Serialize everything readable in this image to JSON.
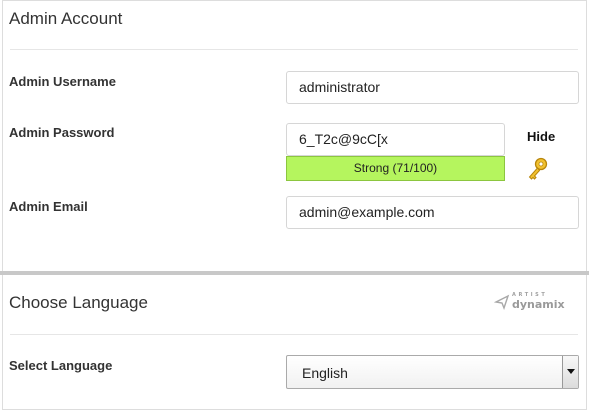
{
  "admin_account": {
    "title": "Admin Account",
    "username": {
      "label": "Admin Username",
      "value": "administrator"
    },
    "password": {
      "label": "Admin Password",
      "value": "6_T2c@9cC[x",
      "strength_text": "Strong (71/100)",
      "strength_score": 71,
      "strength_color": "#b5f55e",
      "hide_label": "Hide",
      "generate_icon": "key-icon"
    },
    "email": {
      "label": "Admin Email",
      "value": "admin@example.com"
    }
  },
  "language": {
    "title": "Choose Language",
    "logo": {
      "small_text": "ARTIST",
      "big_text": "dynamix"
    },
    "select": {
      "label": "Select Language",
      "value": "English"
    }
  }
}
